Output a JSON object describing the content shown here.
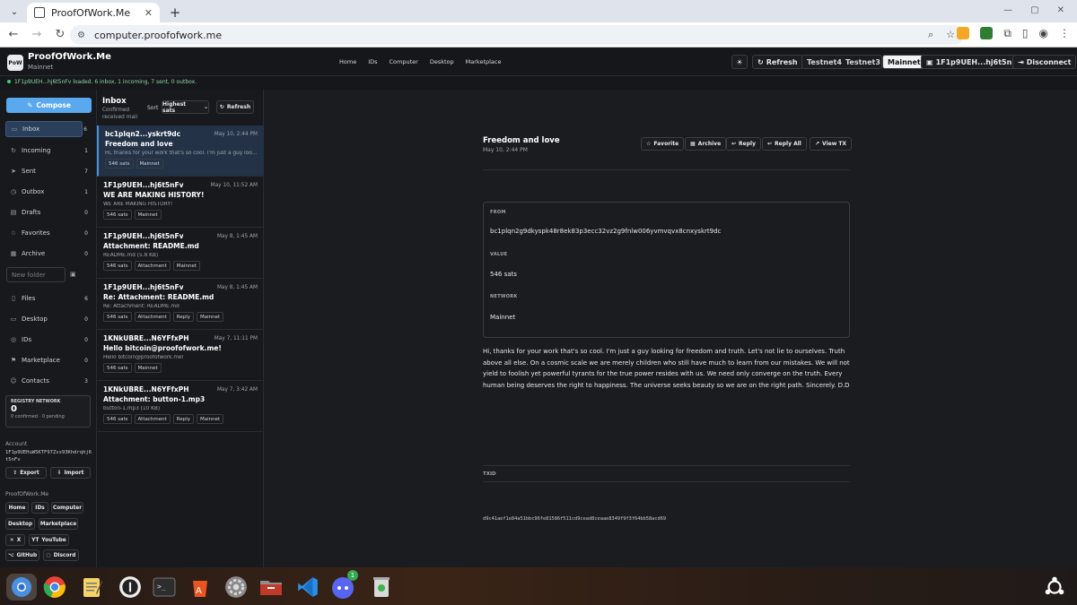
{
  "browser": {
    "tab_title": "ProofOfWork.Me",
    "url": "computer.proofofwork.me"
  },
  "app": {
    "logo": "PoW",
    "name": "ProofOfWork.Me",
    "network_sub": "Mainnet",
    "nav": [
      "Home",
      "IDs",
      "Computer",
      "Desktop",
      "Marketplace"
    ],
    "refresh_label": "Refresh",
    "networks": [
      "Testnet4",
      "Testnet3",
      "Mainnet"
    ],
    "active_network": "Mainnet",
    "account_short": "1F1p9UEH...hj6t5nFv",
    "disconnect_label": "Disconnect",
    "status": "1F1p9UEH...hj6t5nFv loaded. 6 inbox, 1 incoming, 7 sent, 0 outbox."
  },
  "sidebar": {
    "compose_label": "Compose",
    "items": [
      {
        "label": "Inbox",
        "count": "6",
        "icon": "inbox-icon"
      },
      {
        "label": "Incoming",
        "count": "1",
        "icon": "incoming-icon"
      },
      {
        "label": "Sent",
        "count": "7",
        "icon": "send-icon"
      },
      {
        "label": "Outbox",
        "count": "1",
        "icon": "clock-icon"
      },
      {
        "label": "Drafts",
        "count": "0",
        "icon": "draft-icon"
      },
      {
        "label": "Favorites",
        "count": "0",
        "icon": "star-icon"
      },
      {
        "label": "Archive",
        "count": "0",
        "icon": "archive-icon"
      }
    ],
    "new_folder_placeholder": "New folder",
    "items2": [
      {
        "label": "Files",
        "count": "6",
        "icon": "file-icon"
      },
      {
        "label": "Desktop",
        "count": "0",
        "icon": "desktop-icon"
      },
      {
        "label": "IDs",
        "count": "0",
        "icon": "id-icon"
      },
      {
        "label": "Marketplace",
        "count": "0",
        "icon": "shop-icon"
      },
      {
        "label": "Contacts",
        "count": "3",
        "icon": "contacts-icon"
      }
    ],
    "registry": {
      "title": "REGISTRY NETWORK",
      "number": "0",
      "sub": "0 confirmed · 0 pending"
    },
    "account_label": "Account",
    "account": "1F1p9UEHuW5KTF97Zsx93Khdrqhj6t5nFv",
    "export_label": "Export",
    "import_label": "Import",
    "pow_label": "ProofOfWork.Me",
    "links": [
      "Home",
      "IDs",
      "Computer",
      "Desktop",
      "Marketplace",
      "X",
      "YouTube",
      "GitHub",
      "Discord"
    ]
  },
  "inbox": {
    "title": "Inbox",
    "subtitle": "Confirmed received mail",
    "sort_label": "Sort",
    "sort_value": "Highest sats",
    "refresh_label": "Refresh",
    "messages": [
      {
        "from": "bc1plqn2...yskrt9dc",
        "date": "May 10, 2:44 PM",
        "subject": "Freedom and love",
        "preview": "Hi, thanks for your work that's so cool. I'm just a guy looking for freedom and truth.",
        "tags": [
          "546 sats",
          "Mainnet"
        ]
      },
      {
        "from": "1F1p9UEH...hj6t5nFv",
        "date": "May 10, 11:52 AM",
        "subject": "WE ARE MAKING HISTORY!",
        "preview": "WE ARE MAKING HISTORY!",
        "tags": [
          "546 sats",
          "Mainnet"
        ]
      },
      {
        "from": "1F1p9UEH...hj6t5nFv",
        "date": "May 8, 1:45 AM",
        "subject": "Attachment: README.md",
        "preview": "README.md (5.8 KB)",
        "tags": [
          "546 sats",
          "Attachment",
          "Mainnet"
        ]
      },
      {
        "from": "1F1p9UEH...hj6t5nFv",
        "date": "May 8, 1:45 AM",
        "subject": "Re: Attachment: README.md",
        "preview": "Re: Attachment: README.md",
        "tags": [
          "546 sats",
          "Attachment",
          "Reply",
          "Mainnet"
        ]
      },
      {
        "from": "1KNkUBRE...N6YFfxPH",
        "date": "May 7, 11:11 PM",
        "subject": "Hello bitcoin@proofofwork.me!",
        "preview": "Hello bitcoin@proofofwork.me!",
        "tags": [
          "546 sats",
          "Mainnet"
        ]
      },
      {
        "from": "1KNkUBRE...N6YFfxPH",
        "date": "May 7, 3:42 AM",
        "subject": "Attachment: button-1.mp3",
        "preview": "button-1.mp3 (10 KB)",
        "tags": [
          "546 sats",
          "Attachment",
          "Reply",
          "Mainnet"
        ]
      }
    ]
  },
  "reader": {
    "subject": "Freedom and love",
    "date": "May 10, 2:44 PM",
    "actions": [
      "Favorite",
      "Archive",
      "Reply",
      "Reply All",
      "View TX"
    ],
    "from_label": "FROM",
    "from": "bc1plqn2g9dkyspk48r8ek83p3ecc32vz2g9fnlw006yvmvqvx8cnxyskrt9dc",
    "value_label": "VALUE",
    "value": "546 sats",
    "network_label": "NETWORK",
    "network": "Mainnet",
    "body": "Hi, thanks for your work that's so cool. I'm just a guy looking for freedom and truth. Let's not lie to ourselves. Truth above all else. On a cosmic scale we are merely children who still have much to learn from our mistakes. We will not yield to foolish yet powerful tyrants for the true power resides with us. We need only converge on the truth. Every human being deserves the right to happiness. The universe seeks beauty so we are on the right path.  Sincerely. D.D",
    "txid_label": "TXID",
    "txid": "d9c41aef1e84a51bbc96fe81586f511cd9cead8ceaae8349f9f3f64bb58acd69"
  },
  "taskbar": {
    "discord_badge": "1"
  }
}
